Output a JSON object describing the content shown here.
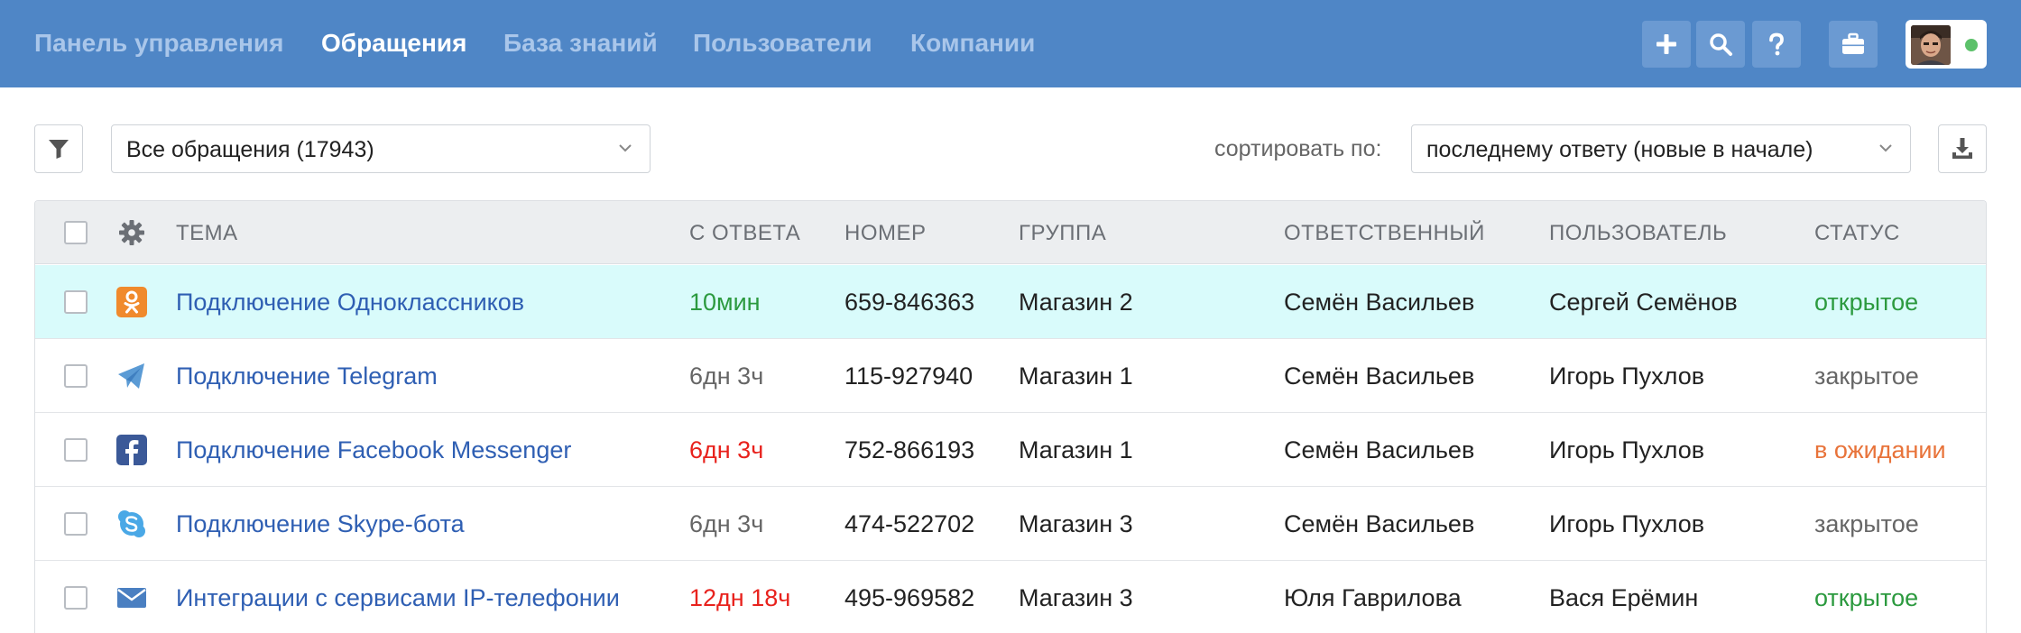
{
  "nav": {
    "items": [
      {
        "label": "Панель управления",
        "active": false
      },
      {
        "label": "Обращения",
        "active": true
      },
      {
        "label": "База знаний",
        "active": false
      },
      {
        "label": "Пользователи",
        "active": false
      },
      {
        "label": "Компании",
        "active": false
      }
    ],
    "actions": [
      "plus-icon",
      "search-icon",
      "help-icon",
      "briefcase-icon"
    ]
  },
  "user": {
    "status_color": "#5cc16a"
  },
  "filter": {
    "view_select": "Все обращения (17943)",
    "sort_label": "сортировать по:",
    "sort_select": "последнему ответу (новые в начале)"
  },
  "table": {
    "columns": [
      "ТЕМА",
      "С ОТВЕТА",
      "НОМЕР",
      "ГРУППА",
      "ОТВЕТСТВЕННЫЙ",
      "ПОЛЬЗОВАТЕЛЬ",
      "СТАТУС"
    ],
    "rows": [
      {
        "channel": "odnoklassniki-icon",
        "subject": "Подключение Одноклассников",
        "since": "10мин",
        "since_color": "green",
        "number": "659-846363",
        "group": "Магазин 2",
        "assignee": "Семён Васильев",
        "user": "Сергей Семёнов",
        "status": "открытое",
        "status_color": "green",
        "highlight": true
      },
      {
        "channel": "telegram-icon",
        "subject": "Подключение Telegram",
        "since": "6дн 3ч",
        "since_color": "gray",
        "number": "115-927940",
        "group": "Магазин 1",
        "assignee": "Семён Васильев",
        "user": "Игорь Пухлов",
        "status": "закрытое",
        "status_color": "gray",
        "highlight": false
      },
      {
        "channel": "facebook-icon",
        "subject": "Подключение Facebook Messenger",
        "since": "6дн 3ч",
        "since_color": "red",
        "number": "752-866193",
        "group": "Магазин 1",
        "assignee": "Семён Васильев",
        "user": "Игорь Пухлов",
        "status": "в ожидании",
        "status_color": "orange",
        "highlight": false
      },
      {
        "channel": "skype-icon",
        "subject": "Подключение Skype-бота",
        "since": "6дн 3ч",
        "since_color": "gray",
        "number": "474-522702",
        "group": "Магазин 3",
        "assignee": "Семён Васильев",
        "user": "Игорь Пухлов",
        "status": "закрытое",
        "status_color": "gray",
        "highlight": false
      },
      {
        "channel": "email-icon",
        "subject": "Интеграции с сервисами IP-телефонии",
        "since": "12дн 18ч",
        "since_color": "red",
        "number": "495-969582",
        "group": "Магазин 3",
        "assignee": "Юля Гаврилова",
        "user": "Вася Ерёмин",
        "status": "открытое",
        "status_color": "green",
        "highlight": false
      }
    ]
  },
  "colors": {
    "topbar": "#4f86c6",
    "link": "#2f5fb3",
    "highlight_row": "#d9fbfb",
    "green": "#2c9a3f",
    "red": "#e8221d",
    "orange": "#e8733a",
    "gray": "#666666"
  }
}
